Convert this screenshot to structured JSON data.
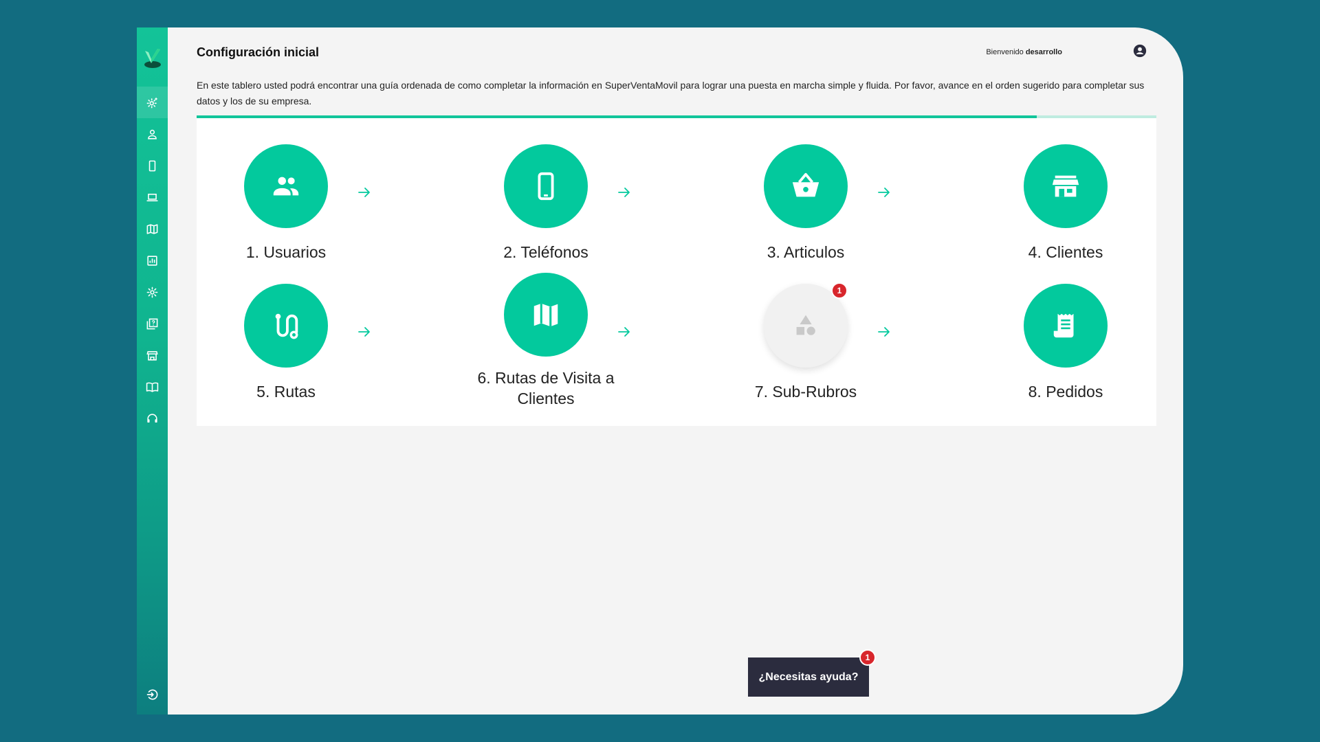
{
  "header": {
    "title": "Configuración inicial",
    "welcome_prefix": "Bienvenido",
    "username": "desarrollo"
  },
  "intro_text": "En este tablero usted podrá encontrar una guía ordenada de como completar la información en SuperVentaMovil para lograr una puesta en marcha simple y fluida. Por favor, avance en el orden sugerido para completar sus datos y los de su empresa.",
  "progress": {
    "completed_fraction": 0.875
  },
  "steps": [
    {
      "label": "1. Usuarios",
      "icon": "users-icon",
      "completed": true
    },
    {
      "label": "2. Teléfonos",
      "icon": "phone-icon",
      "completed": true
    },
    {
      "label": "3. Articulos",
      "icon": "basket-icon",
      "completed": true
    },
    {
      "label": "4. Clientes",
      "icon": "store-icon",
      "completed": true
    },
    {
      "label": "5. Rutas",
      "icon": "route-icon",
      "completed": true
    },
    {
      "label": "6. Rutas de Visita a Clientes",
      "icon": "map-icon",
      "completed": true
    },
    {
      "label": "7. Sub-Rubros",
      "icon": "category-shapes-icon",
      "completed": false,
      "badge": "1"
    },
    {
      "label": "8. Pedidos",
      "icon": "receipt-icon",
      "completed": true
    }
  ],
  "sidebar": {
    "items": [
      {
        "icon": "settings-wizard-icon",
        "active": true
      },
      {
        "icon": "user-icon"
      },
      {
        "icon": "phone-icon"
      },
      {
        "icon": "laptop-icon"
      },
      {
        "icon": "map-icon"
      },
      {
        "icon": "chart-icon"
      },
      {
        "icon": "gear-icon"
      },
      {
        "icon": "faq-icon"
      },
      {
        "icon": "store-icon"
      },
      {
        "icon": "book-icon"
      },
      {
        "icon": "support-icon"
      }
    ],
    "logout_icon": "logout-icon"
  },
  "help": {
    "label": "¿Necesitas ayuda?",
    "badge": "1"
  },
  "colors": {
    "accent": "#03c99d",
    "background": "#126c80",
    "panel": "#f4f4f4",
    "badge": "#d8262c",
    "help_button": "#2b2c3e"
  }
}
